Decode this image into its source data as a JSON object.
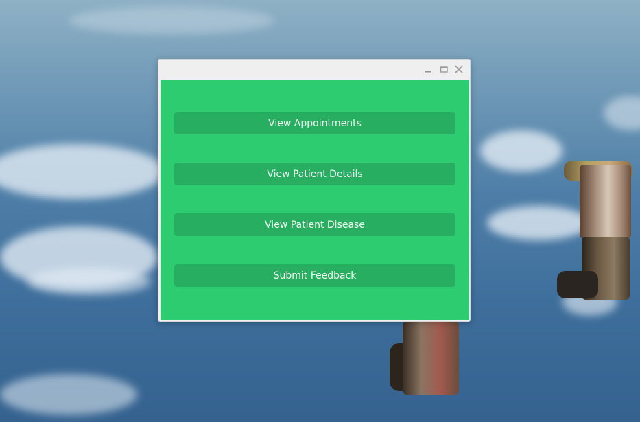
{
  "window": {
    "controls": {
      "minimize_icon": "minimize-icon",
      "maximize_icon": "maximize-icon",
      "close_icon": "close-icon"
    }
  },
  "menu": {
    "buttons": [
      {
        "label": "View Appointments"
      },
      {
        "label": "View Patient Details"
      },
      {
        "label": "View Patient Disease"
      },
      {
        "label": "Submit Feedback"
      }
    ]
  },
  "colors": {
    "content_background": "#2ecc71",
    "button_background": "#27ae60",
    "button_text": "#f2fff6",
    "titlebar": "#efefef"
  }
}
